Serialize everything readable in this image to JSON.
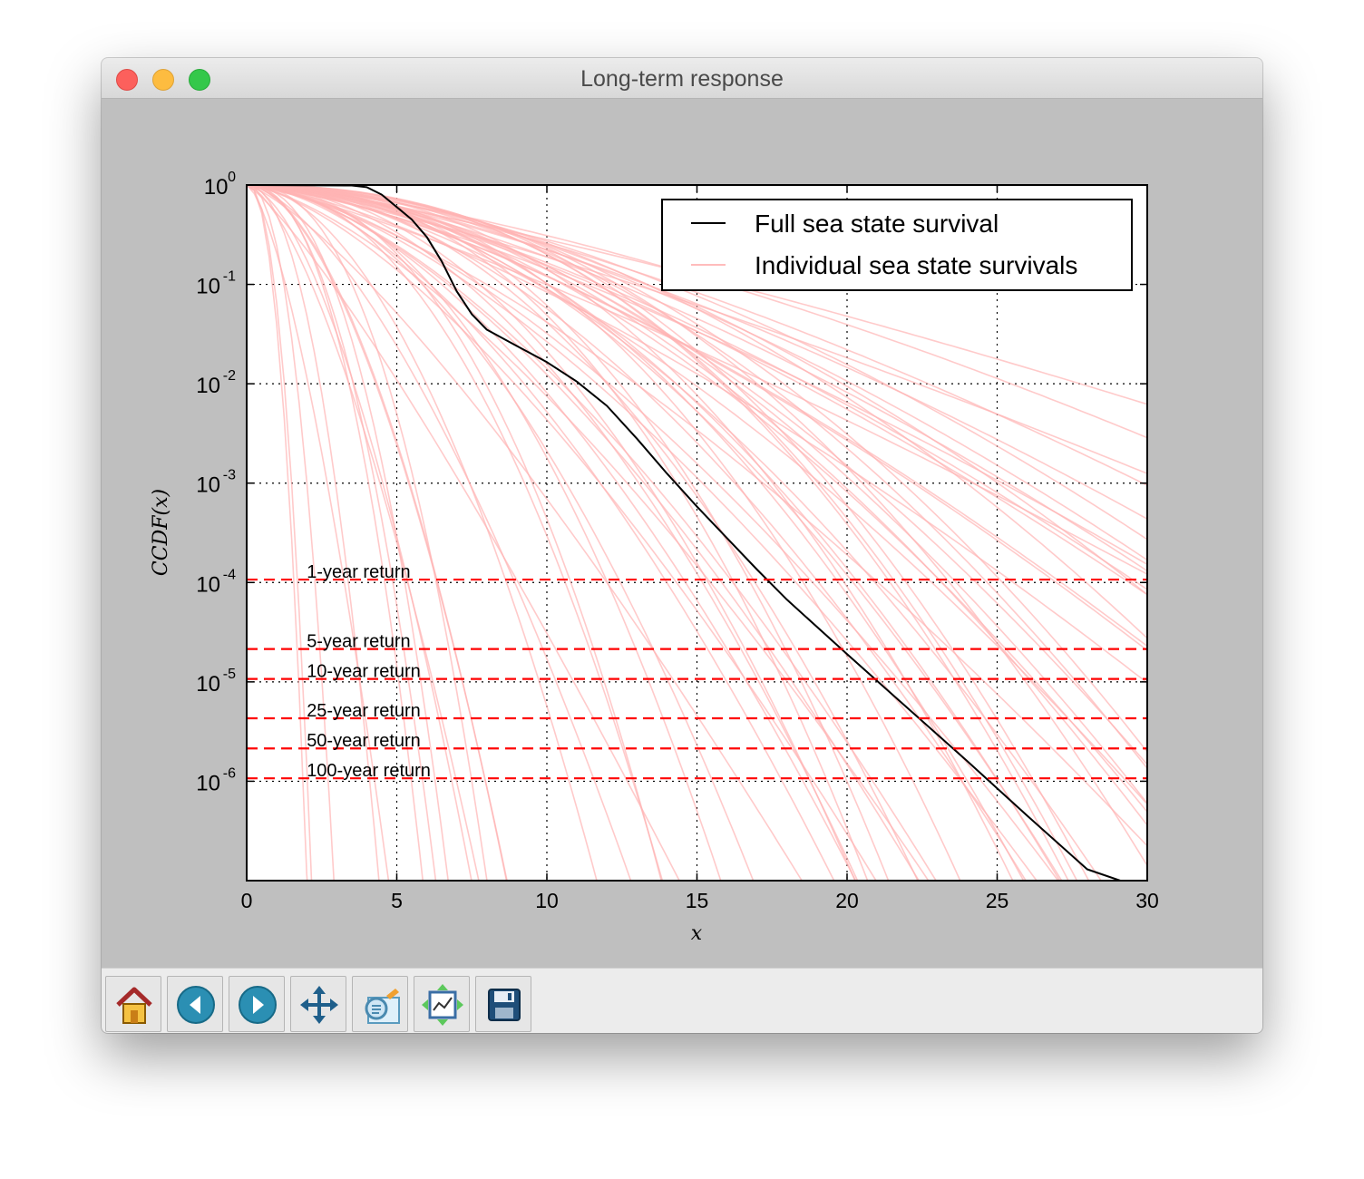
{
  "window": {
    "title": "Long-term response"
  },
  "toolbar": {
    "buttons": [
      {
        "icon": "home-icon",
        "label": "Home"
      },
      {
        "icon": "back-icon",
        "label": "Back"
      },
      {
        "icon": "forward-icon",
        "label": "Forward"
      },
      {
        "icon": "pan-icon",
        "label": "Pan"
      },
      {
        "icon": "zoom-icon",
        "label": "Zoom"
      },
      {
        "icon": "subplots-icon",
        "label": "Subplots"
      },
      {
        "icon": "save-icon",
        "label": "Save"
      }
    ]
  },
  "chart_data": {
    "type": "line",
    "title": "",
    "xlabel": "x",
    "ylabel": "CCDF(x)",
    "xlim": [
      0,
      30
    ],
    "ylim": [
      1e-07,
      1
    ],
    "yscale": "log",
    "grid": true,
    "x_ticks": [
      "0",
      "5",
      "10",
      "15",
      "20",
      "25",
      "30"
    ],
    "y_ticks": [
      {
        "base": "10",
        "exp": "0",
        "value": 1
      },
      {
        "base": "10",
        "exp": "-1",
        "value": 0.1
      },
      {
        "base": "10",
        "exp": "-2",
        "value": 0.01
      },
      {
        "base": "10",
        "exp": "-3",
        "value": 0.001
      },
      {
        "base": "10",
        "exp": "-4",
        "value": 0.0001
      },
      {
        "base": "10",
        "exp": "-5",
        "value": 1e-05
      },
      {
        "base": "10",
        "exp": "-6",
        "value": 1e-06
      }
    ],
    "legend": {
      "position": "upper-right",
      "entries": [
        {
          "label": "Full sea state survival",
          "color": "#000000"
        },
        {
          "label": "Individual sea state survivals",
          "color": "#ffb3b3"
        }
      ]
    },
    "series": [
      {
        "name": "Full sea state survival",
        "color": "#000000",
        "x": [
          0,
          3.5,
          4,
          4.5,
          5,
          5.5,
          6,
          6.5,
          7,
          7.5,
          8,
          9,
          10,
          11,
          12,
          13,
          14,
          15,
          16,
          17,
          18,
          20,
          22,
          24,
          26,
          28,
          29.1
        ],
        "y": [
          1,
          0.99,
          0.95,
          0.8,
          0.6,
          0.45,
          0.3,
          0.17,
          0.085,
          0.05,
          0.035,
          0.024,
          0.0165,
          0.0105,
          0.006,
          0.0028,
          0.00125,
          0.00058,
          0.00028,
          0.000135,
          6.7e-05,
          1.9e-05,
          5.5e-06,
          1.6e-06,
          4.5e-07,
          1.3e-07,
          1e-07
        ]
      }
    ],
    "individual_series": {
      "color": "#ffb3b3",
      "count": 70,
      "scale_range": [
        0.6,
        9.0
      ],
      "shape_range": [
        1.2,
        2.4
      ]
    },
    "return_levels": {
      "color": "#ff0000",
      "lines": [
        {
          "label": "1-year return",
          "y": 0.000107
        },
        {
          "label": "5-year return",
          "y": 2.14e-05
        },
        {
          "label": "10-year return",
          "y": 1.07e-05
        },
        {
          "label": "25-year return",
          "y": 4.3e-06
        },
        {
          "label": "50-year return",
          "y": 2.14e-06
        },
        {
          "label": "100-year return",
          "y": 1.07e-06
        }
      ]
    }
  }
}
